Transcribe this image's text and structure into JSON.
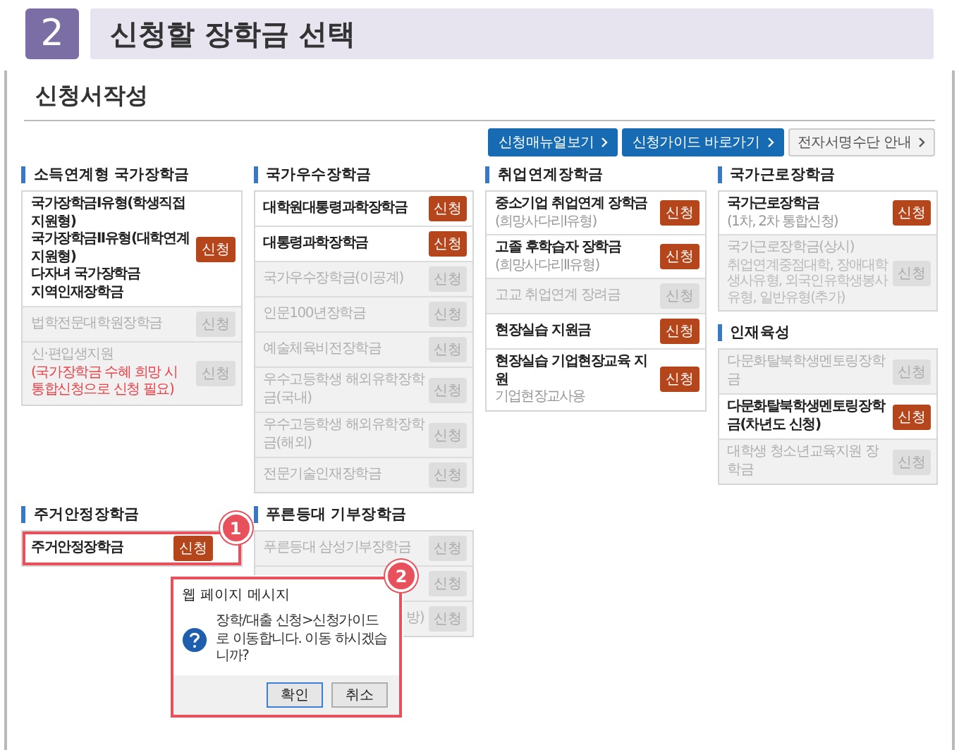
{
  "header": {
    "step": "2",
    "title": "신청할 장학금 선택"
  },
  "page_title": "신청서작성",
  "toolbar": [
    {
      "label": "신청매뉴얼보기",
      "kind": "primary"
    },
    {
      "label": "신청가이드 바로가기",
      "kind": "primary"
    },
    {
      "label": "전자서명수단 안내",
      "kind": "secondary"
    }
  ],
  "top_columns": [
    [
      {
        "title": "소득연계형 국가장학금",
        "items": [
          {
            "lines": [
              "국가장학금Ⅰ유형(학생직접지원형)",
              "국가장학금Ⅱ유형(대학연계지원형)",
              "다자녀 국가장학금",
              "지역인재장학금"
            ],
            "button": "신청",
            "enabled": true
          },
          {
            "lines": [
              "법학전문대학원장학금"
            ],
            "button": "신청",
            "enabled": false
          },
          {
            "lines": [
              "신·편입생지원"
            ],
            "note": "(국가장학금 수혜 희망 시 통합신청으로 신청 필요)",
            "button": "신청",
            "enabled": false
          }
        ]
      }
    ],
    [
      {
        "title": "국가우수장학금",
        "items": [
          {
            "lines": [
              "대학원대통령과학장학금"
            ],
            "button": "신청",
            "enabled": true
          },
          {
            "lines": [
              "대통령과학장학금"
            ],
            "button": "신청",
            "enabled": true
          },
          {
            "lines": [
              "국가우수장학금(이공계)"
            ],
            "button": "신청",
            "enabled": false
          },
          {
            "lines": [
              "인문100년장학금"
            ],
            "button": "신청",
            "enabled": false
          },
          {
            "lines": [
              "예술체육비전장학금"
            ],
            "button": "신청",
            "enabled": false
          },
          {
            "lines": [
              "우수고등학생 해외유학장학금(국내)"
            ],
            "button": "신청",
            "enabled": false
          },
          {
            "lines": [
              "우수고등학생 해외유학장학금(해외)"
            ],
            "button": "신청",
            "enabled": false
          },
          {
            "lines": [
              "전문기술인재장학금"
            ],
            "button": "신청",
            "enabled": false
          }
        ]
      }
    ],
    [
      {
        "title": "취업연계장학금",
        "items": [
          {
            "lines": [
              "중소기업 취업연계 장학금"
            ],
            "sub": "(희망사다리Ⅰ유형)",
            "button": "신청",
            "enabled": true
          },
          {
            "lines": [
              "고졸 후학습자 장학금"
            ],
            "sub": "(희망사다리Ⅱ유형)",
            "button": "신청",
            "enabled": true
          },
          {
            "lines": [
              "고교 취업연계 장려금"
            ],
            "button": "신청",
            "enabled": false
          },
          {
            "lines": [
              "현장실습 지원금"
            ],
            "button": "신청",
            "enabled": true
          },
          {
            "lines": [
              "현장실습 기업현장교육 지원"
            ],
            "sub": "기업현장교사용",
            "button": "신청",
            "enabled": true
          }
        ]
      }
    ],
    [
      {
        "title": "국가근로장학금",
        "items": [
          {
            "lines": [
              "국가근로장학금"
            ],
            "sub": "(1차, 2차 통합신청)",
            "button": "신청",
            "enabled": true
          },
          {
            "lines": [
              "국가근로장학금(상시)"
            ],
            "sub": "취업연계중점대학, 장애대학생사유형, 외국인유학생봉사유형, 일반유형(추가)",
            "button": "신청",
            "enabled": false
          }
        ]
      },
      {
        "title": "인재육성",
        "items": [
          {
            "lines": [
              "다문화탈북학생멘토링장학금"
            ],
            "button": "신청",
            "enabled": false
          },
          {
            "lines": [
              "다문화탈북학생멘토링장학금(차년도 신청)"
            ],
            "button": "신청",
            "enabled": true
          },
          {
            "lines": [
              "대학생 청소년교육지원 장학금"
            ],
            "button": "신청",
            "enabled": false
          }
        ]
      }
    ]
  ],
  "bottom_columns": [
    [
      {
        "title": "주거안정장학금",
        "items": [
          {
            "lines": [
              "주거안정장학금"
            ],
            "button": "신청",
            "enabled": true,
            "highlighted": true,
            "callout": "1"
          }
        ]
      }
    ],
    [
      {
        "title": "푸른등대 기부장학금",
        "items": [
          {
            "lines": [
              "푸른등대 삼성기부장학금"
            ],
            "button": "신청",
            "enabled": false
          },
          {
            "button": "신청",
            "enabled": false
          },
          {
            "lines": [
              "방)"
            ],
            "button": "신청",
            "enabled": false
          }
        ]
      }
    ]
  ],
  "dialog": {
    "title": "웹 페이지 메시지",
    "message": "장학/대출 신청>신청가이드로 이동합니다. 이동 하시겠습니까?",
    "callout": "2",
    "buttons": [
      {
        "label": "확인",
        "focused": true
      },
      {
        "label": "취소",
        "focused": false
      }
    ]
  }
}
